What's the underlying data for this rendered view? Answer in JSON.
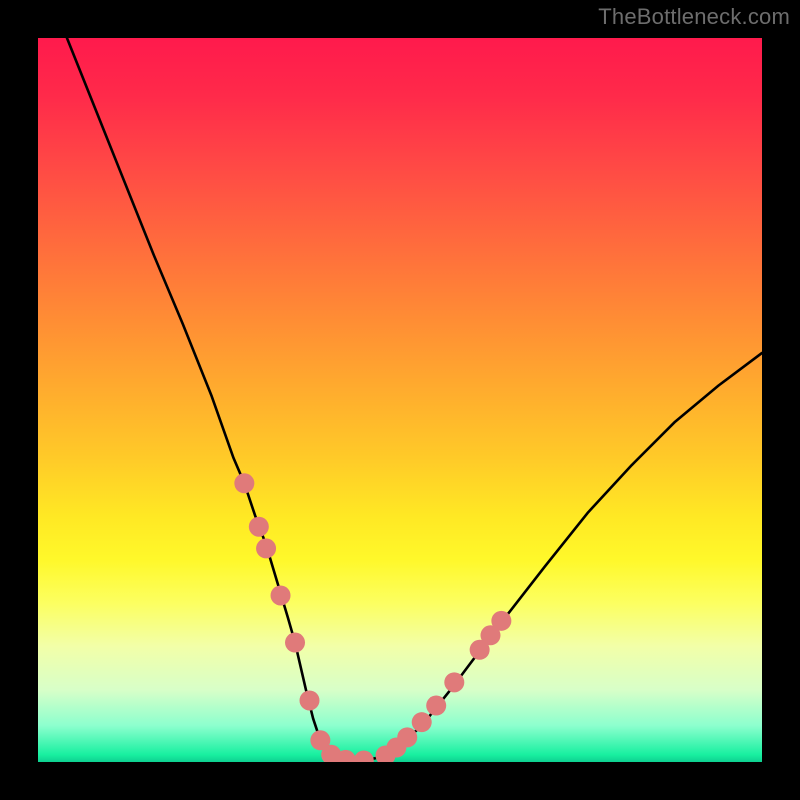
{
  "watermark": "TheBottleneck.com",
  "chart_data": {
    "type": "line",
    "title": "",
    "xlabel": "",
    "ylabel": "",
    "xlim": [
      0,
      100
    ],
    "ylim": [
      0,
      100
    ],
    "grid": false,
    "x": [
      4,
      8,
      12,
      16,
      20,
      24,
      27,
      28.5,
      30,
      31.5,
      33,
      34.5,
      35.5,
      37,
      38,
      39,
      40,
      41,
      43,
      45,
      47,
      49,
      53,
      57,
      63,
      70,
      76,
      82,
      88,
      94,
      100
    ],
    "values": [
      100,
      90,
      80,
      70,
      60.5,
      50.5,
      42,
      38.5,
      34,
      30,
      25,
      20,
      16.5,
      10,
      6,
      3,
      1.4,
      0.6,
      0.2,
      0.2,
      0.6,
      1.5,
      5,
      10,
      18,
      27,
      34.5,
      41,
      47,
      52,
      56.5
    ],
    "markers": {
      "color_hex": "#e07a7a",
      "radius_px": 10,
      "points": [
        {
          "x": 28.5,
          "y": 38.5
        },
        {
          "x": 30.5,
          "y": 32.5
        },
        {
          "x": 31.5,
          "y": 29.5
        },
        {
          "x": 33.5,
          "y": 23
        },
        {
          "x": 35.5,
          "y": 16.5
        },
        {
          "x": 37.5,
          "y": 8.5
        },
        {
          "x": 39,
          "y": 3
        },
        {
          "x": 40.5,
          "y": 1
        },
        {
          "x": 42.5,
          "y": 0.3
        },
        {
          "x": 45,
          "y": 0.2
        },
        {
          "x": 48,
          "y": 0.9
        },
        {
          "x": 49.5,
          "y": 2
        },
        {
          "x": 51,
          "y": 3.4
        },
        {
          "x": 53,
          "y": 5.5
        },
        {
          "x": 55,
          "y": 7.8
        },
        {
          "x": 57.5,
          "y": 11
        },
        {
          "x": 61,
          "y": 15.5
        },
        {
          "x": 62.5,
          "y": 17.5
        },
        {
          "x": 64,
          "y": 19.5
        }
      ]
    }
  }
}
